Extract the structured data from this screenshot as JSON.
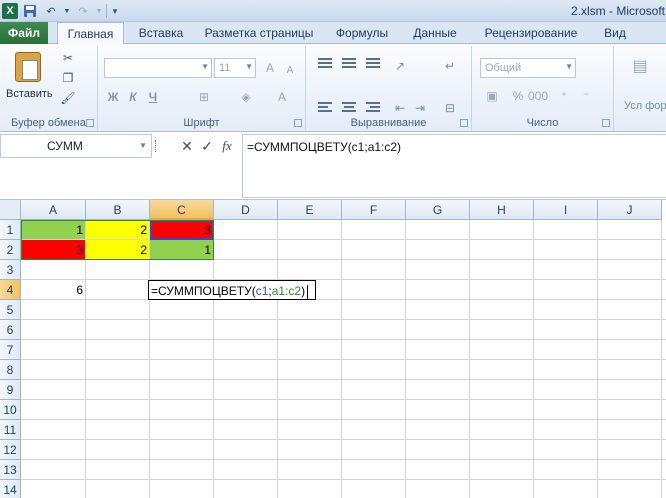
{
  "window": {
    "title": "2.xlsm - Microsoft"
  },
  "ribbon": {
    "tabs": [
      "Файл",
      "Главная",
      "Вставка",
      "Разметка страницы",
      "Формулы",
      "Данные",
      "Рецензирование",
      "Вид"
    ],
    "active_tab": "Главная",
    "groups": {
      "clipboard": {
        "label": "Буфер обмена",
        "paste_label": "Вставить"
      },
      "font": {
        "label": "Шрифт",
        "font_name": "",
        "font_size": "11",
        "bold": "Ж",
        "italic": "К",
        "underline": "Ч"
      },
      "alignment": {
        "label": "Выравнивание"
      },
      "number": {
        "label": "Число",
        "format": "Общий"
      },
      "styles": {
        "label": "Усл форматир"
      }
    }
  },
  "formula_bar": {
    "name_box": "СУММ",
    "fx_label": "fx",
    "formula": "=СУММПОЦВЕТУ(c1;a1:c2)"
  },
  "sheet": {
    "columns": [
      "A",
      "B",
      "C",
      "D",
      "E",
      "F",
      "G",
      "H",
      "I",
      "J"
    ],
    "rows": [
      "1",
      "2",
      "3",
      "4",
      "5",
      "6",
      "7",
      "8",
      "9",
      "10",
      "11",
      "12",
      "13",
      "14"
    ],
    "cells": {
      "A1": "1",
      "B1": "2",
      "C1": "3",
      "A2": "3",
      "B2": "2",
      "C2": "1",
      "A4": "6"
    },
    "cell_colors": {
      "A1": "#92d050",
      "B1": "#ffff00",
      "C1": "#ff0000",
      "A2": "#ff0000",
      "B2": "#ffff00",
      "C2": "#92d050"
    },
    "editing_cell": "C4",
    "editing_parts": {
      "prefix": "=СУММПОЦВЕТУ(",
      "ref1": "c1",
      "sep": ";",
      "ref2": "a1:c2",
      "suffix": ")"
    }
  }
}
